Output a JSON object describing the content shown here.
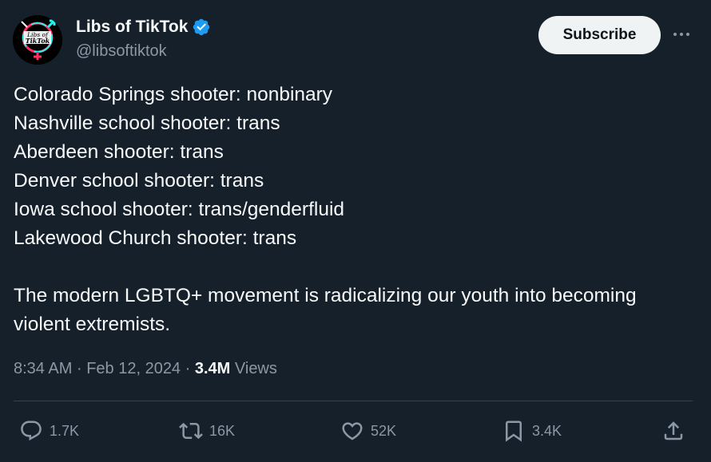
{
  "author": {
    "display_name": "Libs of TikTok",
    "handle": "@libsoftiktok",
    "verified": true,
    "avatar_logo_text": "Libs of TikTok"
  },
  "header": {
    "subscribe_label": "Subscribe",
    "more_icon": "more-horizontal-icon"
  },
  "tweet": {
    "lines": [
      "Colorado Springs shooter: nonbinary",
      "Nashville school shooter: trans",
      "Aberdeen shooter: trans",
      "Denver school shooter: trans",
      "Iowa school shooter: trans/genderfluid",
      "Lakewood Church shooter: trans"
    ],
    "paragraph": "The modern LGBTQ+ movement is radicalizing our youth into becoming violent extremists."
  },
  "meta": {
    "time": "8:34 AM",
    "separator": "·",
    "date": "Feb 12, 2024",
    "views_count": "3.4M",
    "views_label": "Views"
  },
  "actions": {
    "replies": "1.7K",
    "reposts": "16K",
    "likes": "52K",
    "bookmarks": "3.4K"
  },
  "colors": {
    "background": "#15202b",
    "text": "#f7f9f9",
    "secondary": "#8b98a5",
    "verified": "#1d9bf0",
    "subscribe_bg": "#eff3f4"
  }
}
